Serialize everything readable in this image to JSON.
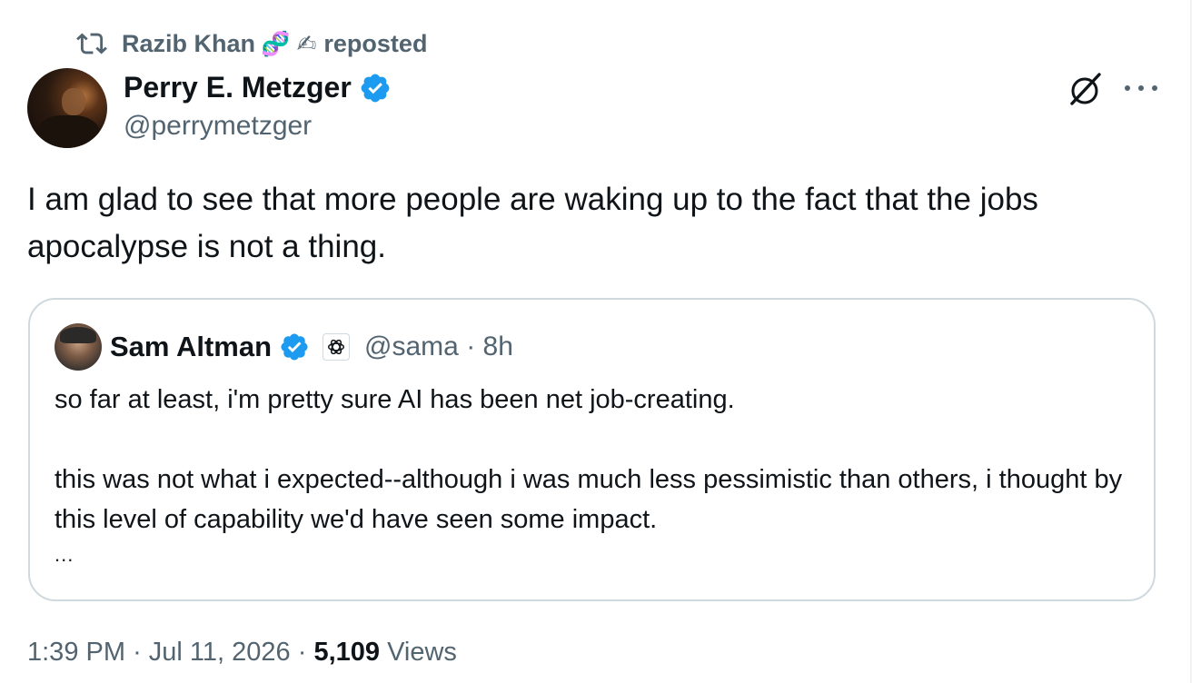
{
  "repost": {
    "name": "Razib Khan",
    "emojis": "🧬 ✍",
    "suffix": "reposted"
  },
  "tweet": {
    "author_name": "Perry E. Metzger",
    "author_handle": "@perrymetzger",
    "text": "I am glad to see that more people are waking up to the fact that the jobs apocalypse is not a thing.",
    "time": "1:39 PM",
    "date": "Jul 11, 2026",
    "views_count": "5,109",
    "views_label": "Views"
  },
  "quote": {
    "author_name": "Sam Altman",
    "author_handle": "@sama",
    "age": "8h",
    "text": "so far at least, i'm pretty sure AI has been net job-creating.\n\nthis was not what i expected--although i was much less pessimistic than others, i thought by this level of capability we'd have seen some impact.",
    "truncation": "..."
  },
  "icons": {
    "repost": "repost-icon",
    "verified": "verified-badge-icon",
    "affiliate": "openai-affiliate-icon",
    "grok": "grok-icon",
    "more": "more-options-icon"
  },
  "colors": {
    "text_primary": "#0f1419",
    "text_secondary": "#536471",
    "verified_blue": "#1d9bf0",
    "border": "#cfd9de"
  }
}
